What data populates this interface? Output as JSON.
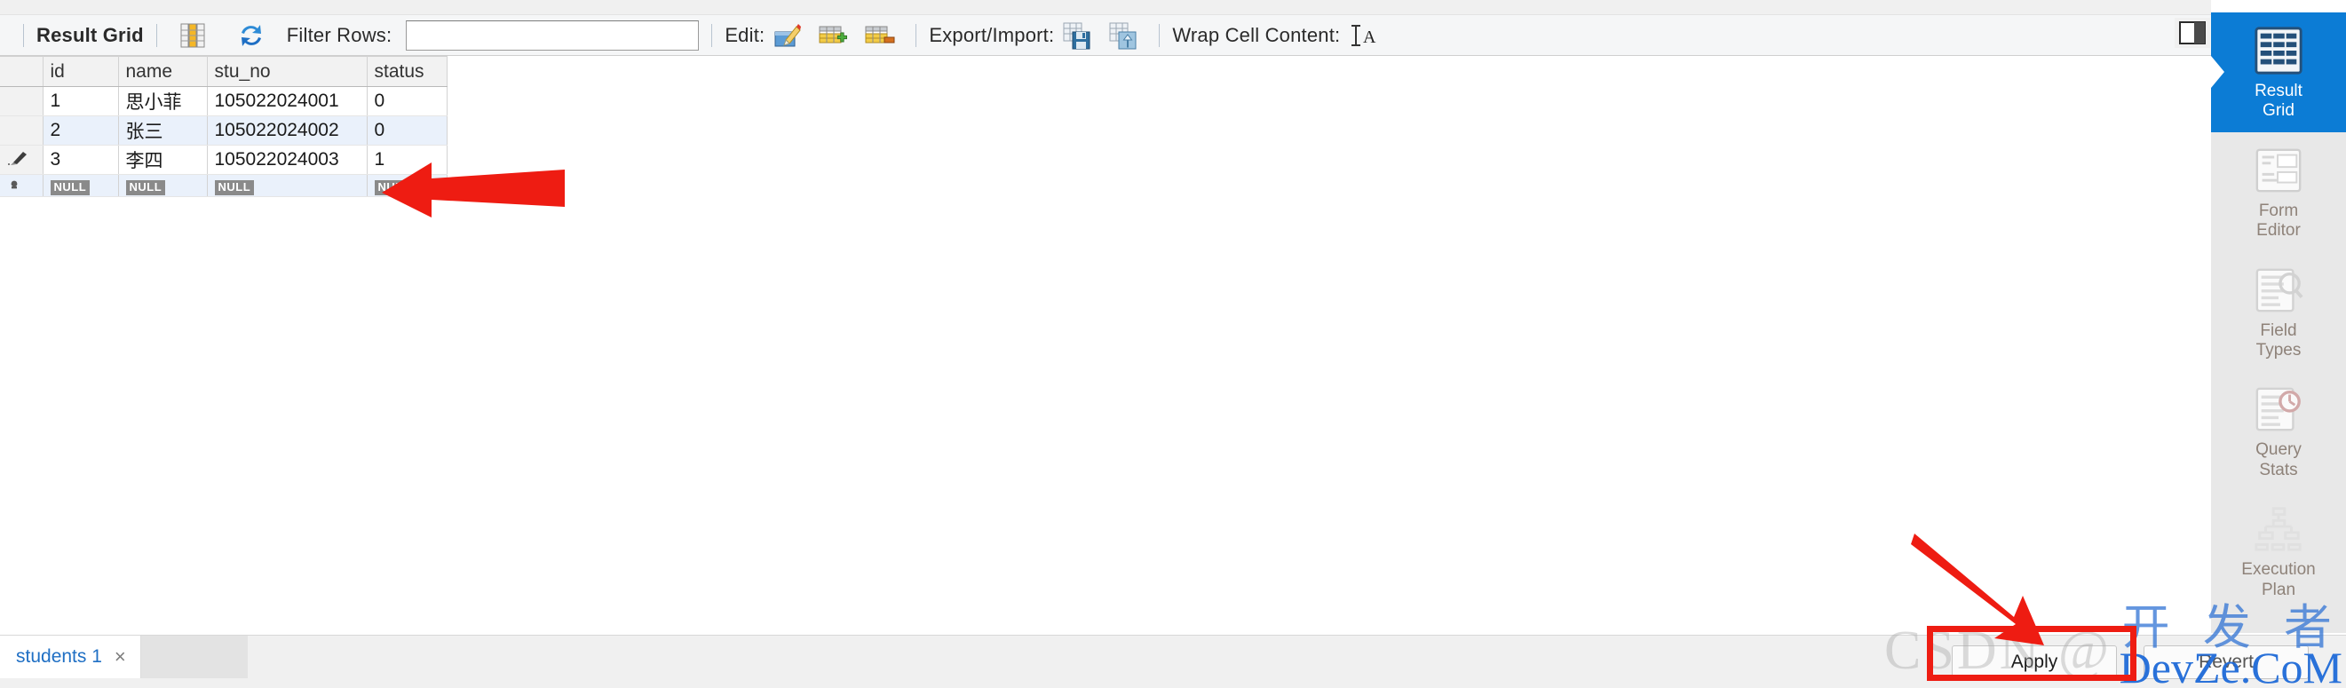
{
  "toolbar": {
    "result_grid_label": "Result Grid",
    "grid_view_icon": "grid-columns-icon",
    "refresh_icon": "refresh-icon",
    "filter_rows_label": "Filter Rows:",
    "filter_rows_value": "",
    "filter_rows_placeholder": "",
    "edit_label": "Edit:",
    "edit_icons": [
      "edit-pencil-icon",
      "insert-row-icon",
      "delete-row-icon"
    ],
    "export_import_label": "Export/Import:",
    "export_import_icons": [
      "export-recordset-icon",
      "import-recordset-icon"
    ],
    "wrap_cell_label": "Wrap Cell Content:",
    "wrap_cell_icon": "wrap-text-icon",
    "panel_toggle_icon": "toggle-sidebar-icon"
  },
  "grid": {
    "columns": [
      "",
      "id",
      "name",
      "stu_no",
      "status"
    ],
    "rows": [
      {
        "gutter": "",
        "id": "1",
        "name": "思小菲",
        "stu_no": "105022024001",
        "status": "0"
      },
      {
        "gutter": "",
        "id": "2",
        "name": "张三",
        "stu_no": "105022024002",
        "status": "0"
      },
      {
        "gutter": "edit-pencil-icon",
        "id": "3",
        "name": "李四",
        "stu_no": "105022024003",
        "status": "1"
      }
    ],
    "new_row": {
      "gutter": "new-row-icon",
      "id": "NULL",
      "name": "NULL",
      "stu_no": "NULL",
      "status": "NULL"
    }
  },
  "sidebar": {
    "items": [
      {
        "label": "Result\nGrid",
        "icon": "result-grid-icon",
        "active": true
      },
      {
        "label": "Form\nEditor",
        "icon": "form-editor-icon",
        "active": false
      },
      {
        "label": "Field\nTypes",
        "icon": "field-types-icon",
        "active": false
      },
      {
        "label": "Query\nStats",
        "icon": "query-stats-icon",
        "active": false
      },
      {
        "label": "Execution\nPlan",
        "icon": "execution-plan-icon",
        "active": false
      }
    ]
  },
  "bottom": {
    "tabs": [
      {
        "label": "students 1",
        "close": "×"
      }
    ],
    "apply_label": "Apply",
    "revert_label": "Revert"
  },
  "watermarks": {
    "csdn": "CSDN @",
    "cn": "开 发 者",
    "devze": "DevZe.CoM"
  },
  "colors": {
    "accent": "#0c7cd5",
    "annotation": "#ee1c12",
    "link": "#1f6fc4",
    "alt_row": "#eaf1fb"
  }
}
